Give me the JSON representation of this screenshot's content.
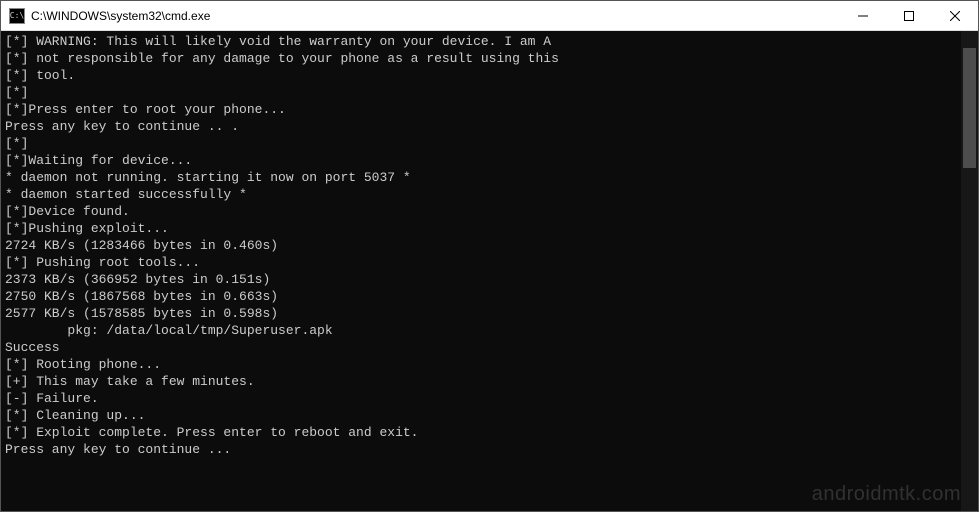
{
  "titlebar": {
    "icon_text": "C:\\",
    "title": "C:\\WINDOWS\\system32\\cmd.exe"
  },
  "terminal": {
    "lines": [
      "[*] WARNING: This will likely void the warranty on your device. I am A",
      "[*] not responsible for any damage to your phone as a result using this",
      "[*] tool.",
      "[*]",
      "[*]Press enter to root your phone...",
      "Press any key to continue .. .",
      "[*]",
      "[*]Waiting for device...",
      "* daemon not running. starting it now on port 5037 *",
      "* daemon started successfully *",
      "[*]Device found.",
      "[*]Pushing exploit...",
      "2724 KB/s (1283466 bytes in 0.460s)",
      "[*] Pushing root tools...",
      "2373 KB/s (366952 bytes in 0.151s)",
      "2750 KB/s (1867568 bytes in 0.663s)",
      "2577 KB/s (1578585 bytes in 0.598s)",
      "        pkg: /data/local/tmp/Superuser.apk",
      "Success",
      "[*] Rooting phone...",
      "[+] This may take a few minutes.",
      "[-] Failure.",
      "[*] Cleaning up...",
      "[*] Exploit complete. Press enter to reboot and exit.",
      "Press any key to continue ..."
    ]
  },
  "watermark": "androidmtk.com"
}
